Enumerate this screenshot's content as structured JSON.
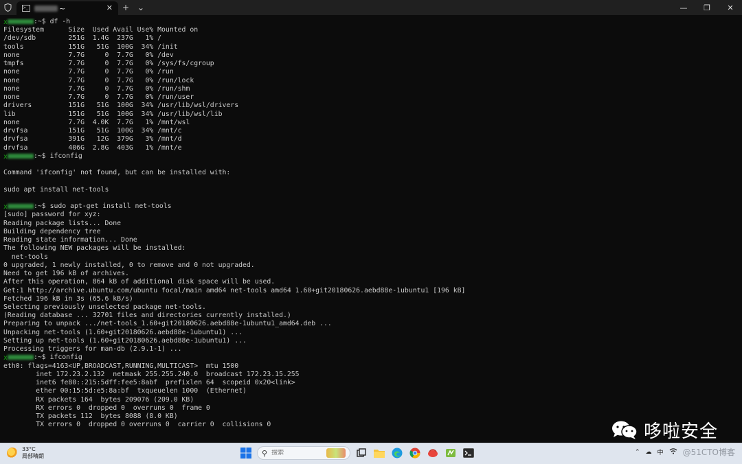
{
  "titlebar": {
    "tab_title": "~",
    "icons": {
      "shield": "shield-icon",
      "terminal": "terminal-icon",
      "close": "close-icon",
      "new_tab": "plus-icon",
      "dropdown": "chevron-down-icon"
    },
    "window_controls": [
      "minimize-icon",
      "maximize-icon",
      "close-icon"
    ]
  },
  "terminal": {
    "lines": [
      {
        "type": "prompt",
        "path": ":~$ ",
        "cmd": "df -h"
      },
      {
        "type": "out",
        "text": "Filesystem      Size  Used Avail Use% Mounted on"
      },
      {
        "type": "out",
        "text": "/dev/sdb        251G  1.4G  237G   1% /"
      },
      {
        "type": "out",
        "text": "tools           151G   51G  100G  34% /init"
      },
      {
        "type": "out",
        "text": "none            7.7G     0  7.7G   0% /dev"
      },
      {
        "type": "out",
        "text": "tmpfs           7.7G     0  7.7G   0% /sys/fs/cgroup"
      },
      {
        "type": "out",
        "text": "none            7.7G     0  7.7G   0% /run"
      },
      {
        "type": "out",
        "text": "none            7.7G     0  7.7G   0% /run/lock"
      },
      {
        "type": "out",
        "text": "none            7.7G     0  7.7G   0% /run/shm"
      },
      {
        "type": "out",
        "text": "none            7.7G     0  7.7G   0% /run/user"
      },
      {
        "type": "out",
        "text": "drivers         151G   51G  100G  34% /usr/lib/wsl/drivers"
      },
      {
        "type": "out",
        "text": "lib             151G   51G  100G  34% /usr/lib/wsl/lib"
      },
      {
        "type": "out",
        "text": "none            7.7G  4.0K  7.7G   1% /mnt/wsl"
      },
      {
        "type": "out",
        "text": "drvfsa          151G   51G  100G  34% /mnt/c"
      },
      {
        "type": "out",
        "text": "drvfsa          391G   12G  379G   3% /mnt/d"
      },
      {
        "type": "out",
        "text": "drvfsa          406G  2.8G  403G   1% /mnt/e"
      },
      {
        "type": "prompt",
        "path": ":~$ ",
        "cmd": "ifconfig"
      },
      {
        "type": "out",
        "text": ""
      },
      {
        "type": "out",
        "text": "Command 'ifconfig' not found, but can be installed with:"
      },
      {
        "type": "out",
        "text": ""
      },
      {
        "type": "out",
        "text": "sudo apt install net-tools"
      },
      {
        "type": "out",
        "text": ""
      },
      {
        "type": "prompt",
        "path": ":~$ ",
        "cmd": "sudo apt-get install net-tools"
      },
      {
        "type": "out",
        "text": "[sudo] password for xyz:"
      },
      {
        "type": "out",
        "text": "Reading package lists... Done"
      },
      {
        "type": "out",
        "text": "Building dependency tree"
      },
      {
        "type": "out",
        "text": "Reading state information... Done"
      },
      {
        "type": "out",
        "text": "The following NEW packages will be installed:"
      },
      {
        "type": "out",
        "text": "  net-tools"
      },
      {
        "type": "out",
        "text": "0 upgraded, 1 newly installed, 0 to remove and 0 not upgraded."
      },
      {
        "type": "out",
        "text": "Need to get 196 kB of archives."
      },
      {
        "type": "out",
        "text": "After this operation, 864 kB of additional disk space will be used."
      },
      {
        "type": "out",
        "text": "Get:1 http://archive.ubuntu.com/ubuntu focal/main amd64 net-tools amd64 1.60+git20180626.aebd88e-1ubuntu1 [196 kB]"
      },
      {
        "type": "out",
        "text": "Fetched 196 kB in 3s (65.6 kB/s)"
      },
      {
        "type": "out",
        "text": "Selecting previously unselected package net-tools."
      },
      {
        "type": "out",
        "text": "(Reading database ... 32701 files and directories currently installed.)"
      },
      {
        "type": "out",
        "text": "Preparing to unpack .../net-tools_1.60+git20180626.aebd88e-1ubuntu1_amd64.deb ..."
      },
      {
        "type": "out",
        "text": "Unpacking net-tools (1.60+git20180626.aebd88e-1ubuntu1) ..."
      },
      {
        "type": "out",
        "text": "Setting up net-tools (1.60+git20180626.aebd88e-1ubuntu1) ..."
      },
      {
        "type": "out",
        "text": "Processing triggers for man-db (2.9.1-1) ..."
      },
      {
        "type": "prompt",
        "path": ":~$ ",
        "cmd": "ifconfig"
      },
      {
        "type": "out",
        "text": "eth0: flags=4163<UP,BROADCAST,RUNNING,MULTICAST>  mtu 1500"
      },
      {
        "type": "out",
        "text": "        inet 172.23.2.132  netmask 255.255.240.0  broadcast 172.23.15.255"
      },
      {
        "type": "out",
        "text": "        inet6 fe80::215:5dff:fee5:8abf  prefixlen 64  scopeid 0x20<link>"
      },
      {
        "type": "out",
        "text": "        ether 00:15:5d:e5:8a:bf  txqueuelen 1000  (Ethernet)"
      },
      {
        "type": "out",
        "text": "        RX packets 164  bytes 209076 (209.0 KB)"
      },
      {
        "type": "out",
        "text": "        RX errors 0  dropped 0  overruns 0  frame 0"
      },
      {
        "type": "out",
        "text": "        TX packets 112  bytes 8088 (8.0 KB)"
      },
      {
        "type": "out",
        "text": "        TX errors 0  dropped 0 overruns 0  carrier 0  collisions 0"
      }
    ]
  },
  "watermark": {
    "text": "哆啦安全",
    "icon": "wechat-icon"
  },
  "taskbar": {
    "weather_temp": "33°C",
    "weather_desc": "局部晴朗",
    "search_placeholder": "搜索",
    "tray_lang": "中",
    "tray_watermark": "@51CTO博客",
    "colors": {
      "background": "#dfe5ee",
      "terminal_bg": "#0c0c0c",
      "prompt_green": "#13a10e"
    }
  }
}
